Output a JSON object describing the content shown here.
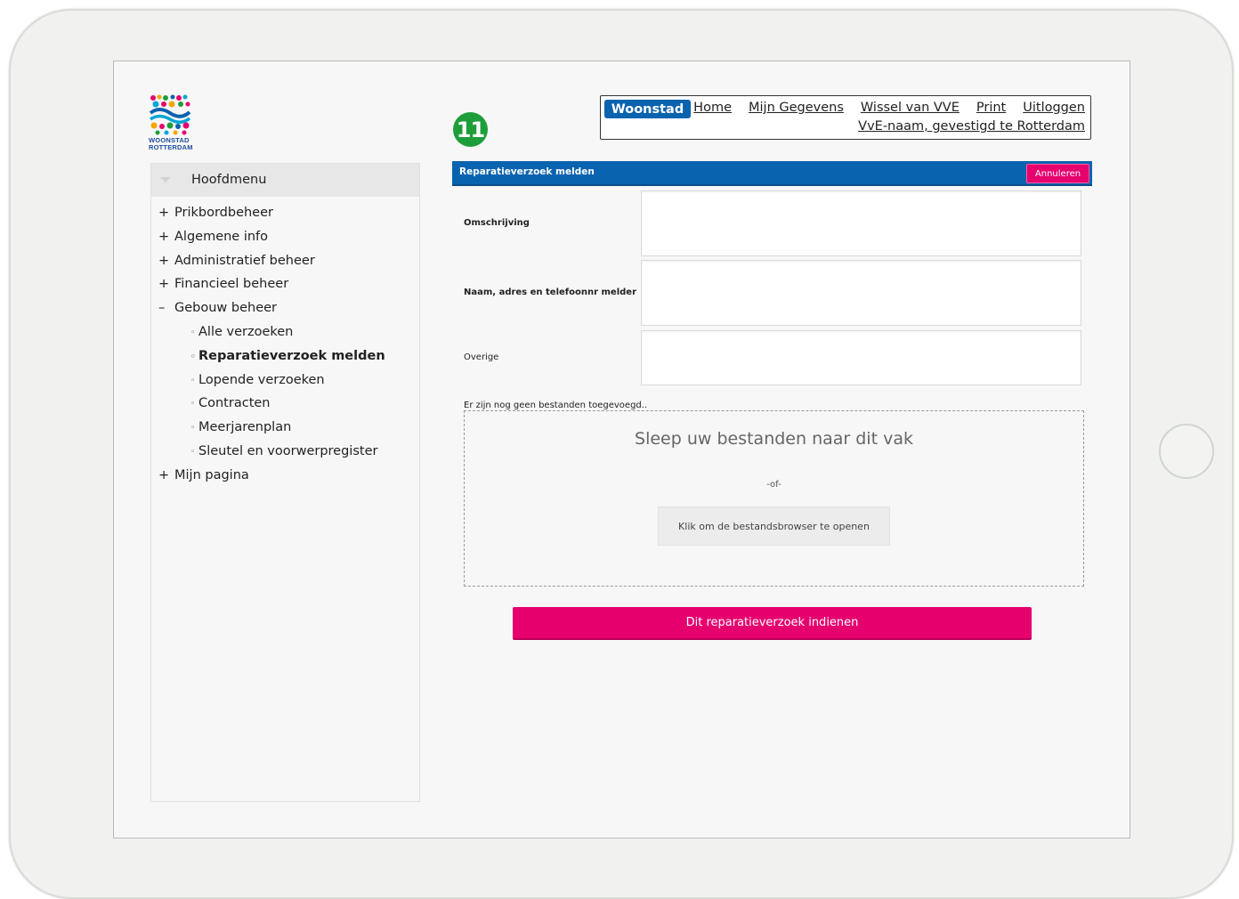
{
  "logo": {
    "line1": "WOONSTAD",
    "line2": "ROTTERDAM"
  },
  "step_badge": "11",
  "topnav": {
    "brand": "Woonstad",
    "links": [
      "Home",
      "Mijn Gegevens",
      "Wissel van VVE",
      "Print",
      "Uitloggen"
    ],
    "vve_link": "VvE-naam, gevestigd te Rotterdam"
  },
  "sidebar": {
    "title": "Hoofdmenu",
    "items": [
      {
        "symbol": "+",
        "label": "Prikbordbeheer"
      },
      {
        "symbol": "+",
        "label": "Algemene info"
      },
      {
        "symbol": "+",
        "label": "Administratief beheer"
      },
      {
        "symbol": "+",
        "label": "Financieel beheer"
      },
      {
        "symbol": "–",
        "label": "Gebouw beheer"
      }
    ],
    "subitems": [
      {
        "bullet": "◦",
        "label": "Alle verzoeken"
      },
      {
        "bullet": "◦",
        "label": "Reparatieverzoek melden"
      },
      {
        "bullet": "◦",
        "label": "Lopende verzoeken"
      },
      {
        "bullet": "◦",
        "label": "Contracten"
      },
      {
        "bullet": "◦",
        "label": "Meerjarenplan"
      },
      {
        "bullet": "◦",
        "label": "Sleutel en voorwerpregister"
      }
    ],
    "last_item": {
      "symbol": "+",
      "label": "Mijn pagina"
    }
  },
  "panel": {
    "title": "Reparatieverzoek melden",
    "cancel_label": "Annuleren"
  },
  "form": {
    "omschrijving_label": "Omschrijving",
    "melder_label": "Naam, adres en telefoonnr melder",
    "overige_label": "Overige",
    "omschrijving_value": "",
    "melder_value": "",
    "overige_value": ""
  },
  "upload": {
    "status": "Er zijn nog geen bestanden toegevoegd..",
    "drop_text": "Sleep uw bestanden naar dit vak",
    "or_text": "-of-",
    "browse_label": "Klik om de bestandsbrowser te openen"
  },
  "submit_label": "Dit reparatieverzoek indienen",
  "colors": {
    "primary_blue": "#0a63ae",
    "accent_pink": "#e6006e",
    "badge_green": "#1e9e3a"
  }
}
